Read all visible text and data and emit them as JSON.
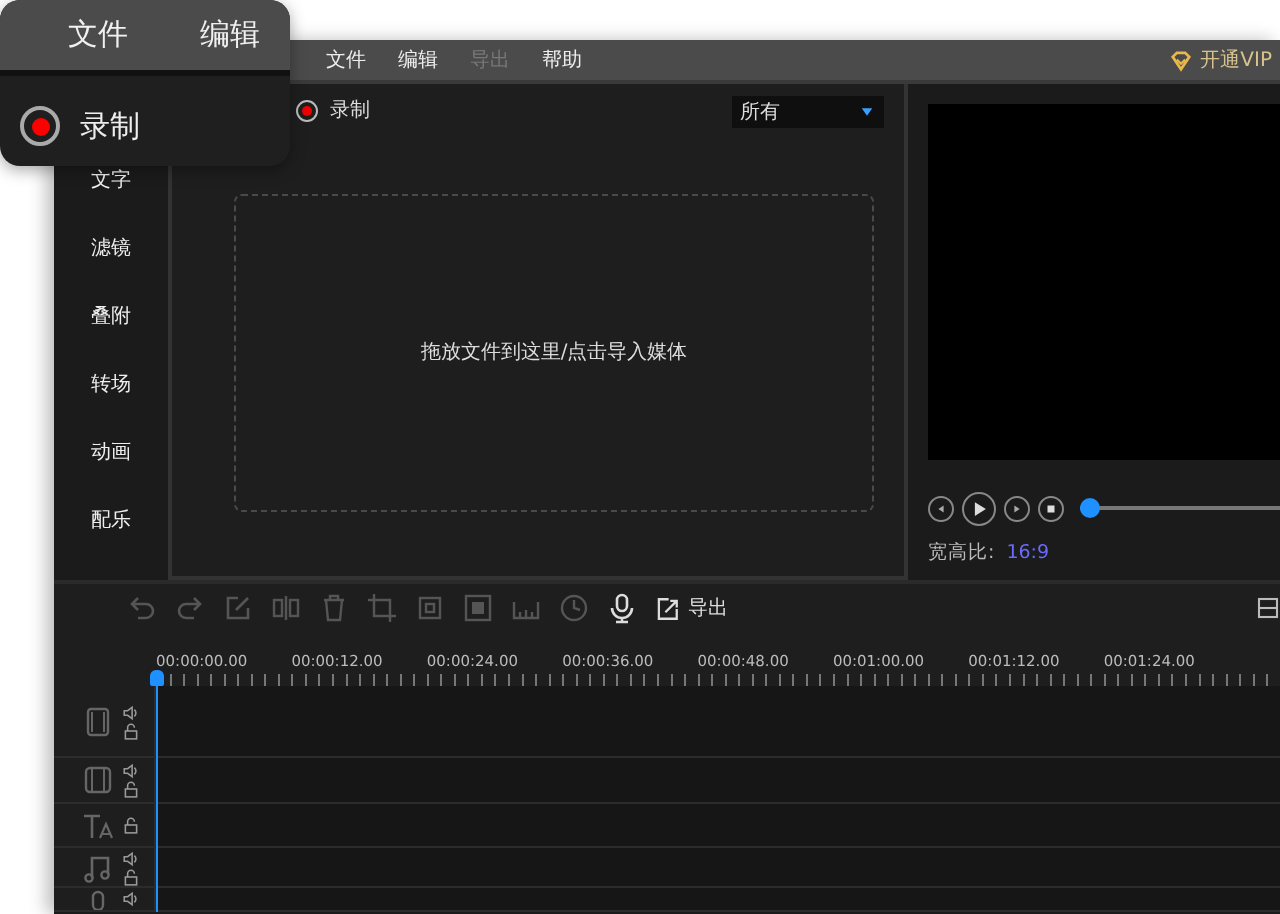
{
  "callout": {
    "menu": [
      "文件",
      "编辑"
    ],
    "radio": {
      "label": "录制",
      "selected": true
    }
  },
  "menubar": {
    "items": [
      {
        "label": "文件",
        "disabled": false
      },
      {
        "label": "编辑",
        "disabled": false
      },
      {
        "label": "导出",
        "disabled": true
      },
      {
        "label": "帮助",
        "disabled": false
      }
    ],
    "vip": "开通VIP"
  },
  "sidebar": {
    "items": [
      {
        "label": "文字",
        "selected": false
      },
      {
        "label": "滤镜",
        "selected": false
      },
      {
        "label": "叠附",
        "selected": false
      },
      {
        "label": "转场",
        "selected": false
      },
      {
        "label": "动画",
        "selected": false
      },
      {
        "label": "配乐",
        "selected": false
      }
    ]
  },
  "media": {
    "radio": {
      "label": "录制",
      "selected": true
    },
    "filter": {
      "value": "所有"
    },
    "dropzone": "拖放文件到这里/点击导入媒体"
  },
  "preview": {
    "buttons": [
      {
        "kind": "previous"
      },
      {
        "kind": "play"
      },
      {
        "kind": "next"
      },
      {
        "kind": "stop"
      }
    ],
    "progress": {
      "level": 0
    },
    "aspect_label": "宽高比:",
    "aspect_value": "16:9"
  },
  "toolbar": {
    "tools": [
      {
        "kind": "undo",
        "disabled": true
      },
      {
        "kind": "redo",
        "disabled": true
      },
      {
        "kind": "edit",
        "disabled": true
      },
      {
        "kind": "split",
        "disabled": true
      },
      {
        "kind": "delete",
        "disabled": true
      },
      {
        "kind": "crop",
        "disabled": true
      },
      {
        "kind": "resize",
        "disabled": true
      },
      {
        "kind": "mosaic",
        "disabled": true
      },
      {
        "kind": "ruler",
        "disabled": true
      },
      {
        "kind": "clock",
        "disabled": true
      },
      {
        "kind": "mic",
        "disabled": false
      }
    ],
    "export": "导出"
  },
  "ruler": {
    "ticks": [
      "00:00:00.00",
      "00:00:12.00",
      "00:00:24.00",
      "00:00:36.00",
      "00:00:48.00",
      "00:01:00.00",
      "00:01:12.00",
      "00:01:24.00"
    ]
  },
  "tracks": [
    {
      "kind": "video"
    },
    {
      "kind": "film"
    },
    {
      "kind": "text"
    },
    {
      "kind": "music"
    },
    {
      "kind": "voice"
    }
  ]
}
